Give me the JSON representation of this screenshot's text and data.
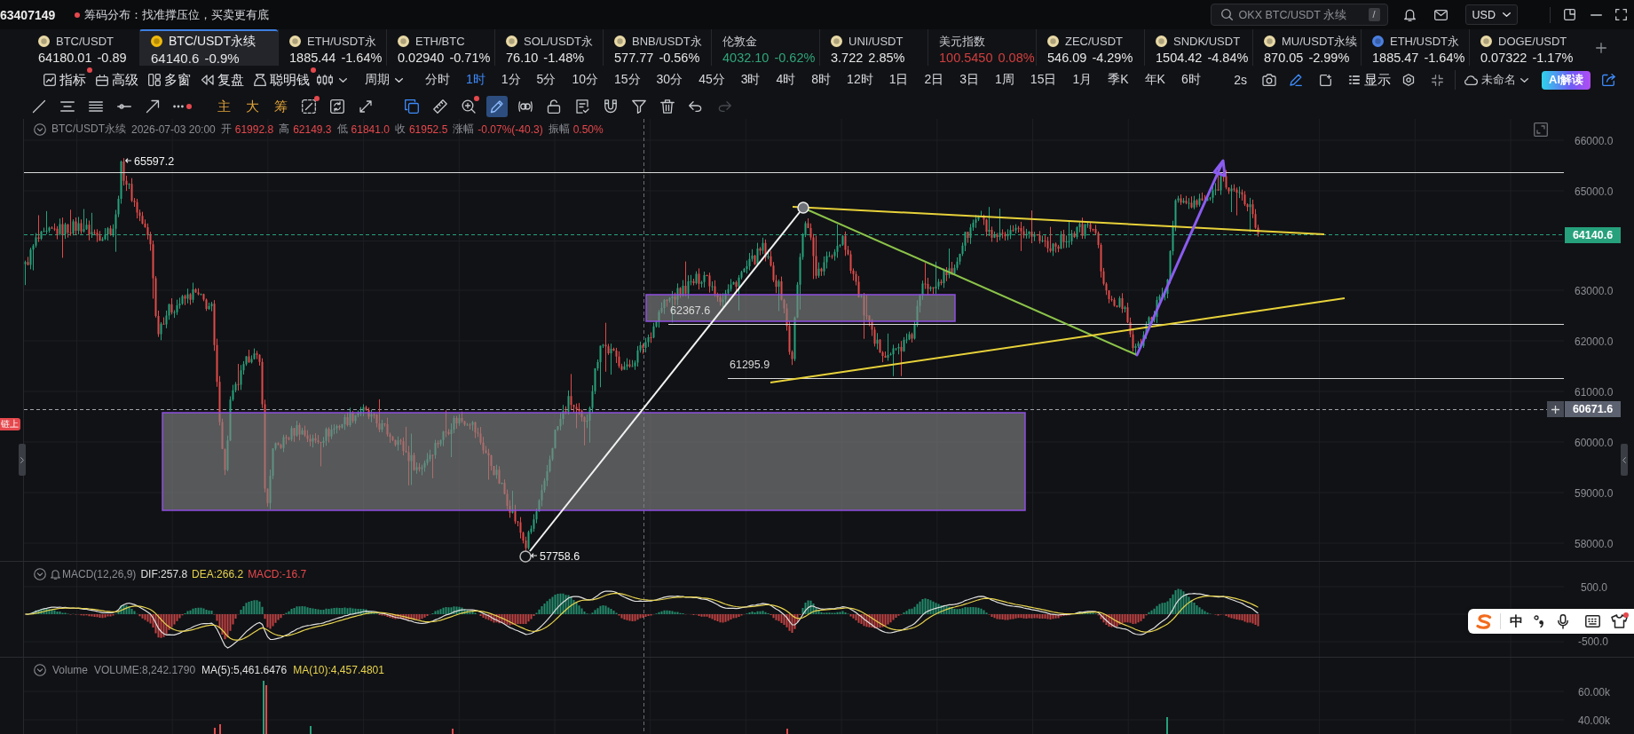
{
  "window": {
    "title": "63407149",
    "notice": "筹码分布：找准撑压位，买卖更有底"
  },
  "search": {
    "placeholder": "OKX BTC/USDT 永续",
    "shortcut": "/"
  },
  "currency": {
    "value": "USD"
  },
  "tickers": [
    {
      "kind": "crypto",
      "name": "BTC/USDT",
      "quote": "64180.01 -0.89",
      "color": "#e6e6e6",
      "selected": false
    },
    {
      "kind": "crypto",
      "name": "BTC/USDT永续",
      "quote": "64140.6 -0.9%",
      "color": "#e6e6e6",
      "selected": true
    },
    {
      "kind": "crypto",
      "name": "ETH/USDT永",
      "quote": "1885.44 -1.64%",
      "color": "#e6e6e6",
      "selected": false
    },
    {
      "kind": "crypto",
      "name": "ETH/BTC",
      "quote": "0.02940 -0.71%",
      "color": "#e6e6e6",
      "selected": false
    },
    {
      "kind": "crypto",
      "name": "SOL/USDT永",
      "quote": "76.10 -1.48%",
      "color": "#e6e6e6",
      "selected": false
    },
    {
      "kind": "crypto",
      "name": "BNB/USDT永",
      "quote": "577.77 -0.56%",
      "color": "#e6e6e6",
      "selected": false
    },
    {
      "kind": "index",
      "name": "伦敦金",
      "quote": "4032.10 -0.62%",
      "color": "#2fa57a",
      "selected": false
    },
    {
      "kind": "crypto",
      "name": "UNI/USDT",
      "quote": "3.722 2.85%",
      "color": "#e6e6e6",
      "selected": false
    },
    {
      "kind": "index",
      "name": "美元指数",
      "quote": "100.5450 0.08%",
      "color": "#d23f3f",
      "selected": false
    },
    {
      "kind": "crypto",
      "name": "ZEC/USDT",
      "quote": "546.09 -4.29%",
      "color": "#e6e6e6",
      "selected": false
    },
    {
      "kind": "crypto",
      "name": "SNDK/USDT",
      "quote": "1504.42 -4.84%",
      "color": "#e6e6e6",
      "selected": false
    },
    {
      "kind": "crypto",
      "name": "MU/USDT永续",
      "quote": "870.05 -2.99%",
      "color": "#e6e6e6",
      "selected": false
    },
    {
      "kind": "crypto",
      "name": "ETH/USDT永",
      "quote": "1885.47 -1.64%",
      "color": "#e6e6e6",
      "selected": false
    },
    {
      "kind": "crypto",
      "name": "DOGE/USDT",
      "quote": "0.07322 -1.17%",
      "color": "#e6e6e6",
      "selected": false
    }
  ],
  "toolbar": {
    "menus": [
      {
        "label": "指标",
        "dot": true
      },
      {
        "label": "高级",
        "dot": false
      },
      {
        "label": "多窗",
        "dot": false
      },
      {
        "label": "复盘",
        "dot": false
      },
      {
        "label": "聪明钱",
        "dot": true
      }
    ],
    "period": "周期",
    "intervals": [
      {
        "label": "分时",
        "selected": false
      },
      {
        "label": "1时",
        "selected": true
      },
      {
        "label": "1分",
        "selected": false
      },
      {
        "label": "5分",
        "selected": false
      },
      {
        "label": "10分",
        "selected": false
      },
      {
        "label": "15分",
        "selected": false
      },
      {
        "label": "30分",
        "selected": false
      },
      {
        "label": "45分",
        "selected": false
      },
      {
        "label": "3时",
        "selected": false
      },
      {
        "label": "4时",
        "selected": false
      },
      {
        "label": "8时",
        "selected": false
      },
      {
        "label": "12时",
        "selected": false
      },
      {
        "label": "1日",
        "selected": false
      },
      {
        "label": "2日",
        "selected": false
      },
      {
        "label": "3日",
        "selected": false
      },
      {
        "label": "1周",
        "selected": false
      },
      {
        "label": "15日",
        "selected": false
      },
      {
        "label": "1月",
        "selected": false
      },
      {
        "label": "季K",
        "selected": false
      },
      {
        "label": "年K",
        "selected": false
      },
      {
        "label": "6时",
        "selected": false
      }
    ],
    "refresh": "2s",
    "tools": [
      {
        "on": false
      },
      {
        "on": true
      },
      {
        "on": false
      }
    ],
    "display": "显示",
    "layout_name": "未命名",
    "ai_button": "AI解读"
  },
  "drawing_tools": [
    [
      {
        "kind": "icon",
        "selected": false,
        "on": false,
        "dot": false,
        "disabled": false
      },
      {
        "kind": "icon",
        "selected": false,
        "on": false,
        "dot": false,
        "disabled": false
      },
      {
        "kind": "icon",
        "selected": false,
        "on": false,
        "dot": false,
        "disabled": false
      },
      {
        "kind": "icon",
        "selected": false,
        "on": false,
        "dot": false,
        "disabled": false
      },
      {
        "kind": "icon",
        "selected": false,
        "on": false,
        "dot": false,
        "disabled": false
      },
      {
        "kind": "icon",
        "selected": false,
        "on": false,
        "dot": true,
        "disabled": false
      }
    ],
    [
      {
        "kind": "text",
        "label": "主"
      },
      {
        "kind": "text",
        "label": "大"
      },
      {
        "kind": "text",
        "label": "筹"
      },
      {
        "kind": "icon",
        "selected": false,
        "on": false,
        "dot": true,
        "disabled": false
      },
      {
        "kind": "icon",
        "selected": false,
        "on": false,
        "dot": false,
        "disabled": false
      },
      {
        "kind": "icon",
        "selected": false,
        "on": false,
        "dot": false,
        "disabled": false
      }
    ],
    [
      {
        "kind": "icon",
        "selected": false,
        "on": true,
        "dot": false,
        "disabled": false
      },
      {
        "kind": "icon",
        "selected": false,
        "on": false,
        "dot": false,
        "disabled": false
      },
      {
        "kind": "icon",
        "selected": false,
        "on": false,
        "dot": true,
        "disabled": false
      },
      {
        "kind": "icon",
        "selected": true,
        "on": false,
        "dot": false,
        "disabled": false
      },
      {
        "kind": "icon",
        "selected": false,
        "on": false,
        "dot": false,
        "disabled": false
      },
      {
        "kind": "icon",
        "selected": false,
        "on": false,
        "dot": false,
        "disabled": false
      },
      {
        "kind": "icon",
        "selected": false,
        "on": false,
        "dot": false,
        "disabled": false
      },
      {
        "kind": "icon",
        "selected": false,
        "on": false,
        "dot": false,
        "disabled": false
      },
      {
        "kind": "icon",
        "selected": false,
        "on": false,
        "dot": false,
        "disabled": false
      },
      {
        "kind": "icon",
        "selected": false,
        "on": false,
        "dot": false,
        "disabled": false
      },
      {
        "kind": "icon",
        "selected": false,
        "on": false,
        "dot": false,
        "disabled": false
      },
      {
        "kind": "icon",
        "selected": false,
        "on": false,
        "dot": false,
        "disabled": true
      }
    ]
  ],
  "chart": {
    "legend": {
      "symbol": "BTC/USDT永续",
      "time": "2026-07-03 20:00",
      "fields": [
        {
          "label": "开",
          "value": "61992.8"
        },
        {
          "label": "高",
          "value": "62149.3"
        },
        {
          "label": "低",
          "value": "61841.0"
        },
        {
          "label": "收",
          "value": "61952.5"
        },
        {
          "label": "涨幅",
          "value": "-0.07%(-40.3)"
        },
        {
          "label": "振幅",
          "value": "0.50%"
        }
      ]
    },
    "price_axis": [
      "66000.0",
      "65000.0",
      "63000.0",
      "62000.0",
      "61000.0",
      "60000.0",
      "59000.0",
      "58000.0"
    ],
    "last_price": "64140.6",
    "cursor_price": "60671.6",
    "markers": [
      {
        "kind": "high",
        "label": "65597.2"
      },
      {
        "kind": "low",
        "label": "57758.6"
      },
      {
        "kind": "level",
        "label": "62367.6"
      },
      {
        "kind": "level",
        "label": "61295.9"
      }
    ],
    "side_tag": "链上"
  },
  "macd": {
    "title": "MACD(12,26,9)",
    "values": [
      {
        "text": "DIF:257.8",
        "color": "#e0e0e0"
      },
      {
        "text": "DEA:266.2",
        "color": "#e8d44d"
      },
      {
        "text": "MACD:-16.7",
        "color": "#e5484d"
      }
    ],
    "axis": [
      "500.0",
      "-500.0"
    ]
  },
  "volume": {
    "title": "Volume",
    "values": [
      {
        "text": "VOLUME:8,242.1790",
        "color": "#8b8e95"
      },
      {
        "text": "MA(5):5,461.6476",
        "color": "#e0e0e0"
      },
      {
        "text": "MA(10):4,457.4801",
        "color": "#e8d44d"
      }
    ],
    "axis": [
      "60.00k",
      "40.00k"
    ]
  },
  "ime": {
    "mode": "中"
  }
}
